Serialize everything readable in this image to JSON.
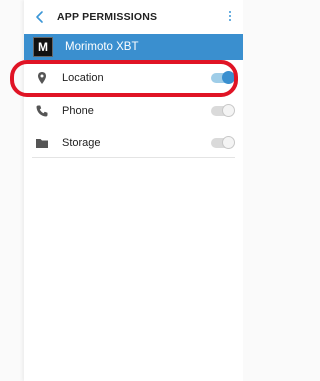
{
  "header": {
    "title": "APP PERMISSIONS",
    "back_icon": "chevron-left-icon",
    "menu_icon": "more-vert-icon"
  },
  "app": {
    "logo_text": "M",
    "name": "Morimoto XBT"
  },
  "permissions": [
    {
      "label": "Location",
      "icon": "location-pin-icon",
      "enabled": true
    },
    {
      "label": "Phone",
      "icon": "phone-icon",
      "enabled": false
    },
    {
      "label": "Storage",
      "icon": "folder-icon",
      "enabled": false
    }
  ],
  "colors": {
    "accent": "#3a8fcf",
    "highlight": "#e01425"
  }
}
